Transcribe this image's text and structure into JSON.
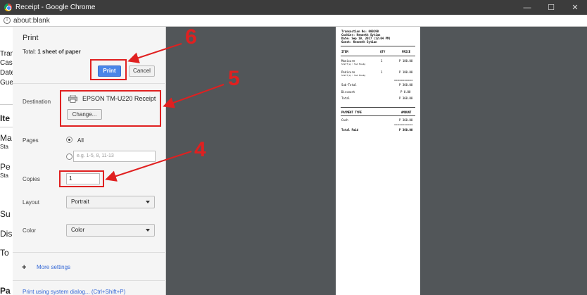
{
  "window": {
    "title": "Receipt - Google Chrome",
    "controls": [
      "—",
      "☐",
      "✕"
    ]
  },
  "address_bar": {
    "url": "about:blank"
  },
  "background_page": {
    "snippets": [
      "Tran",
      "Cas",
      "Date",
      "Gue",
      "Ite",
      "Ma",
      "Sta",
      "Pe",
      "Sta",
      "Su",
      "Dis",
      "To",
      "Pa"
    ]
  },
  "print_panel": {
    "heading": "Print",
    "summary_prefix": "Total:",
    "summary_value": "1 sheet of paper",
    "print_button": "Print",
    "cancel_button": "Cancel",
    "destination": {
      "label": "Destination",
      "printer_name": "EPSON TM-U220 Receipt",
      "change_button": "Change..."
    },
    "pages": {
      "label": "Pages",
      "all_option": "All",
      "custom_placeholder": "e.g. 1-5, 8, 11-13"
    },
    "copies": {
      "label": "Copies",
      "value": "1"
    },
    "layout": {
      "label": "Layout",
      "value": "Portrait"
    },
    "color": {
      "label": "Color",
      "value": "Color"
    },
    "more_settings": "More settings",
    "system_dialog": "Print using system dialog... (Ctrl+Shift+P)"
  },
  "receipt": {
    "header_lines": [
      "Transaction No: 000190",
      "Cashier: Kenneth Sytian",
      "Date: Sep 19, 2017 (12:04 PM)",
      "Guest: Kenneth Sytian"
    ],
    "col_item": "ITEM",
    "col_qty": "QTY",
    "col_price": "PRICE",
    "items": [
      {
        "name": "Manicure",
        "staff": "Staff(s): Ted Mosby",
        "qty": "1",
        "price": "P 180.00"
      },
      {
        "name": "Pedicure",
        "staff": "Staff(s): Ted Mosby",
        "qty": "1",
        "price": "P 180.00"
      }
    ],
    "separator": "===========",
    "subtotal_label": "Sub-Total",
    "subtotal_value": "P 360.00",
    "discount_label": "Discount",
    "discount_value": "P 0.00",
    "total_label": "Total",
    "total_value": "P 360.00",
    "payment_type_label": "PAYMENT TYPE",
    "amount_label": "AMOUNT",
    "payment_method": "Cash",
    "payment_amount": "P 360.00",
    "total_paid_label": "Total Paid",
    "total_paid_value": "P 360.00"
  },
  "annotations": {
    "step_6": "6",
    "step_5": "5",
    "step_4": "4"
  },
  "colors": {
    "annotation": "#e02020",
    "print_button": "#4a86e8",
    "preview_bg": "#525659"
  }
}
